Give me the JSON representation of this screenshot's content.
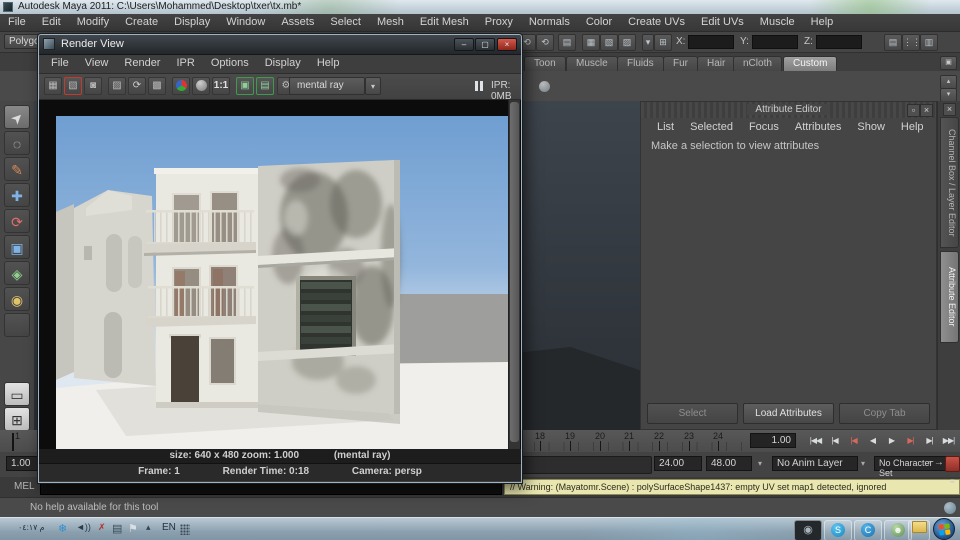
{
  "titlebar": {
    "title": "Autodesk Maya 2011: C:\\Users\\Mohammed\\Desktop\\txer\\tx.mb*"
  },
  "menubar": {
    "items": [
      "File",
      "Edit",
      "Modify",
      "Create",
      "Display",
      "Window",
      "Assets",
      "Select",
      "Mesh",
      "Edit Mesh",
      "Proxy",
      "Normals",
      "Color",
      "Create UVs",
      "Edit UVs",
      "Muscle",
      "Help"
    ]
  },
  "statusline": {
    "menuset": "Polygons",
    "x_label": "X:",
    "y_label": "Y:",
    "z_label": "Z:"
  },
  "shelf": {
    "tabs": [
      "Toon",
      "Muscle",
      "Fluids",
      "Fur",
      "Hair",
      "nCloth",
      "Custom"
    ],
    "active_tab": "Custom"
  },
  "rv": {
    "title": "Render View",
    "menus": [
      "File",
      "View",
      "Render",
      "IPR",
      "Options",
      "Display",
      "Help"
    ],
    "one_to_one": "1:1",
    "renderer": "mental ray",
    "ipr_status": "IPR: 0MB",
    "size_zoom": "size: 640 x 480 zoom: 1.000",
    "renderer_paren": "(mental ray)",
    "frame": "Frame: 1",
    "render_time": "Render Time: 0:18",
    "camera": "Camera: persp"
  },
  "ae": {
    "title": "Attribute Editor",
    "menus": [
      "List",
      "Selected",
      "Focus",
      "Attributes",
      "Show",
      "Help"
    ],
    "message": "Make a selection to view attributes",
    "btn_select": "Select",
    "btn_load": "Load Attributes",
    "btn_copy": "Copy Tab"
  },
  "side": {
    "channel_box": "Channel Box / Layer Editor",
    "attr_editor": "Attribute Editor"
  },
  "tl": {
    "start": "1",
    "ticks": [
      "18",
      "19",
      "20",
      "21",
      "22",
      "23",
      "24"
    ],
    "current": "1.00",
    "playback": [
      "|◀◀",
      "|◀",
      "|◀",
      "◀",
      "▶",
      "▶|",
      "▶|",
      "▶▶|"
    ]
  },
  "rs": {
    "range_start": "1.00",
    "pb_start": "24.00",
    "pb_end": "48.00",
    "anim_layer": "No Anim Layer",
    "char_set": "No Character Set"
  },
  "cmd": {
    "label": "MEL",
    "result": "// Warning: (Mayatomr.Scene) : polySurfaceShape1437: empty UV set map1 detected, ignored"
  },
  "help": {
    "text": "No help available for this tool"
  },
  "task": {
    "clock": "م ٠٤:١٧",
    "lang": "EN"
  },
  "icons": {
    "minimize": "–",
    "maximize": "▢",
    "close": "×",
    "restore": "▫",
    "dropdown": "▾",
    "chevron_up": "▴",
    "snowflake": "❄",
    "flag": "⚑",
    "cross": "✗",
    "skype": "S",
    "blue_app": "C",
    "green_app": "☻",
    "dark_app": "◉"
  },
  "colors": {
    "warning_bg": "#e9e7af",
    "close_red": "#b23a2c",
    "active_tab": "#8d8d8d",
    "ui_bg": "#414141"
  }
}
